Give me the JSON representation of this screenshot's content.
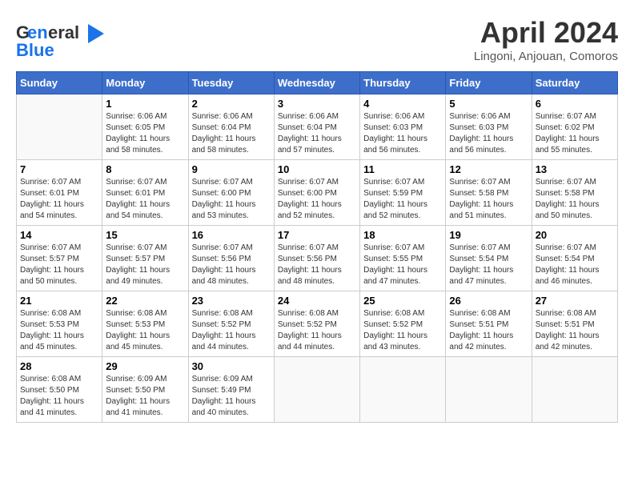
{
  "header": {
    "logo_line1": "General",
    "logo_line2": "Blue",
    "title": "April 2024",
    "subtitle": "Lingoni, Anjouan, Comoros"
  },
  "calendar": {
    "weekdays": [
      "Sunday",
      "Monday",
      "Tuesday",
      "Wednesday",
      "Thursday",
      "Friday",
      "Saturday"
    ],
    "weeks": [
      [
        {
          "day": "",
          "info": ""
        },
        {
          "day": "1",
          "info": "Sunrise: 6:06 AM\nSunset: 6:05 PM\nDaylight: 11 hours\nand 58 minutes."
        },
        {
          "day": "2",
          "info": "Sunrise: 6:06 AM\nSunset: 6:04 PM\nDaylight: 11 hours\nand 58 minutes."
        },
        {
          "day": "3",
          "info": "Sunrise: 6:06 AM\nSunset: 6:04 PM\nDaylight: 11 hours\nand 57 minutes."
        },
        {
          "day": "4",
          "info": "Sunrise: 6:06 AM\nSunset: 6:03 PM\nDaylight: 11 hours\nand 56 minutes."
        },
        {
          "day": "5",
          "info": "Sunrise: 6:06 AM\nSunset: 6:03 PM\nDaylight: 11 hours\nand 56 minutes."
        },
        {
          "day": "6",
          "info": "Sunrise: 6:07 AM\nSunset: 6:02 PM\nDaylight: 11 hours\nand 55 minutes."
        }
      ],
      [
        {
          "day": "7",
          "info": "Sunrise: 6:07 AM\nSunset: 6:01 PM\nDaylight: 11 hours\nand 54 minutes."
        },
        {
          "day": "8",
          "info": "Sunrise: 6:07 AM\nSunset: 6:01 PM\nDaylight: 11 hours\nand 54 minutes."
        },
        {
          "day": "9",
          "info": "Sunrise: 6:07 AM\nSunset: 6:00 PM\nDaylight: 11 hours\nand 53 minutes."
        },
        {
          "day": "10",
          "info": "Sunrise: 6:07 AM\nSunset: 6:00 PM\nDaylight: 11 hours\nand 52 minutes."
        },
        {
          "day": "11",
          "info": "Sunrise: 6:07 AM\nSunset: 5:59 PM\nDaylight: 11 hours\nand 52 minutes."
        },
        {
          "day": "12",
          "info": "Sunrise: 6:07 AM\nSunset: 5:58 PM\nDaylight: 11 hours\nand 51 minutes."
        },
        {
          "day": "13",
          "info": "Sunrise: 6:07 AM\nSunset: 5:58 PM\nDaylight: 11 hours\nand 50 minutes."
        }
      ],
      [
        {
          "day": "14",
          "info": "Sunrise: 6:07 AM\nSunset: 5:57 PM\nDaylight: 11 hours\nand 50 minutes."
        },
        {
          "day": "15",
          "info": "Sunrise: 6:07 AM\nSunset: 5:57 PM\nDaylight: 11 hours\nand 49 minutes."
        },
        {
          "day": "16",
          "info": "Sunrise: 6:07 AM\nSunset: 5:56 PM\nDaylight: 11 hours\nand 48 minutes."
        },
        {
          "day": "17",
          "info": "Sunrise: 6:07 AM\nSunset: 5:56 PM\nDaylight: 11 hours\nand 48 minutes."
        },
        {
          "day": "18",
          "info": "Sunrise: 6:07 AM\nSunset: 5:55 PM\nDaylight: 11 hours\nand 47 minutes."
        },
        {
          "day": "19",
          "info": "Sunrise: 6:07 AM\nSunset: 5:54 PM\nDaylight: 11 hours\nand 47 minutes."
        },
        {
          "day": "20",
          "info": "Sunrise: 6:07 AM\nSunset: 5:54 PM\nDaylight: 11 hours\nand 46 minutes."
        }
      ],
      [
        {
          "day": "21",
          "info": "Sunrise: 6:08 AM\nSunset: 5:53 PM\nDaylight: 11 hours\nand 45 minutes."
        },
        {
          "day": "22",
          "info": "Sunrise: 6:08 AM\nSunset: 5:53 PM\nDaylight: 11 hours\nand 45 minutes."
        },
        {
          "day": "23",
          "info": "Sunrise: 6:08 AM\nSunset: 5:52 PM\nDaylight: 11 hours\nand 44 minutes."
        },
        {
          "day": "24",
          "info": "Sunrise: 6:08 AM\nSunset: 5:52 PM\nDaylight: 11 hours\nand 44 minutes."
        },
        {
          "day": "25",
          "info": "Sunrise: 6:08 AM\nSunset: 5:52 PM\nDaylight: 11 hours\nand 43 minutes."
        },
        {
          "day": "26",
          "info": "Sunrise: 6:08 AM\nSunset: 5:51 PM\nDaylight: 11 hours\nand 42 minutes."
        },
        {
          "day": "27",
          "info": "Sunrise: 6:08 AM\nSunset: 5:51 PM\nDaylight: 11 hours\nand 42 minutes."
        }
      ],
      [
        {
          "day": "28",
          "info": "Sunrise: 6:08 AM\nSunset: 5:50 PM\nDaylight: 11 hours\nand 41 minutes."
        },
        {
          "day": "29",
          "info": "Sunrise: 6:09 AM\nSunset: 5:50 PM\nDaylight: 11 hours\nand 41 minutes."
        },
        {
          "day": "30",
          "info": "Sunrise: 6:09 AM\nSunset: 5:49 PM\nDaylight: 11 hours\nand 40 minutes."
        },
        {
          "day": "",
          "info": ""
        },
        {
          "day": "",
          "info": ""
        },
        {
          "day": "",
          "info": ""
        },
        {
          "day": "",
          "info": ""
        }
      ]
    ]
  }
}
